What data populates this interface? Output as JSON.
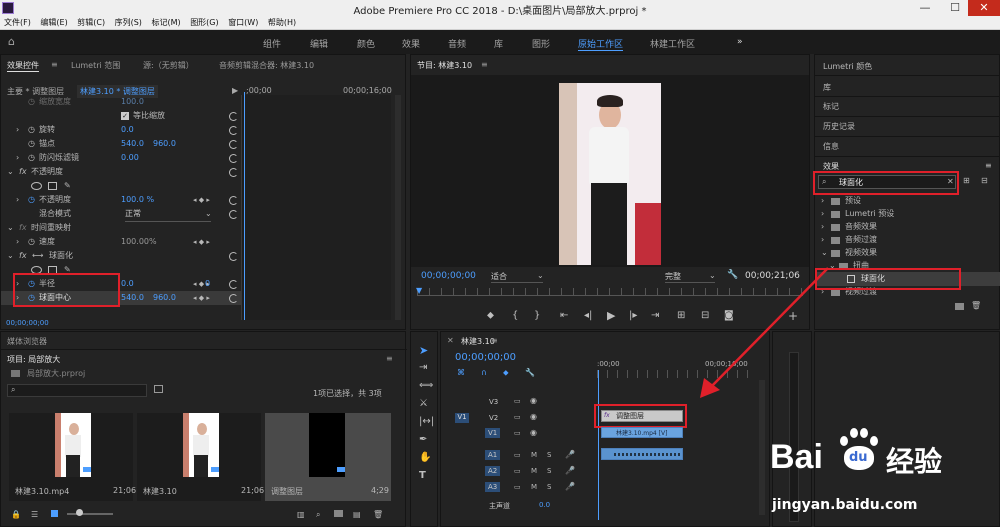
{
  "titlebar": {
    "title": "Adobe Premiere Pro CC 2018 - D:\\桌面图片\\局部放大.prproj *",
    "minimize": "—",
    "maximize": "☐",
    "close": "✕"
  },
  "menu": [
    "文件(F)",
    "编辑(E)",
    "剪辑(C)",
    "序列(S)",
    "标记(M)",
    "图形(G)",
    "窗口(W)",
    "帮助(H)"
  ],
  "workspaces": [
    "组件",
    "编辑",
    "颜色",
    "效果",
    "音频",
    "库",
    "图形",
    "原始工作区",
    "林建工作区"
  ],
  "workspace_more": "»",
  "effect_controls": {
    "tabs": [
      "效果控件",
      "Lumetri 范围",
      "源:（无剪辑）",
      "音频剪辑混合器: 林建3.10"
    ],
    "tab_menu": "≡",
    "source_label": "主要 * 调整图层",
    "clip_label": "林建3.10 * 调整图层",
    "time_marks": [
      ";00;00",
      "00;00;16;00"
    ],
    "rows": [
      {
        "label": "缩放宽度",
        "v1": "100.0",
        "v2": ""
      },
      {
        "label": "等比缩放",
        "v1": "",
        "v2": ""
      },
      {
        "label": "旋转",
        "v1": "0.0",
        "v2": ""
      },
      {
        "label": "锚点",
        "v1": "540.0",
        "v2": "960.0"
      },
      {
        "label": "防闪烁滤镜",
        "v1": "0.00",
        "v2": ""
      },
      {
        "label": "不透明度",
        "v1": "",
        "v2": ""
      },
      {
        "label": "",
        "v1": "",
        "v2": ""
      },
      {
        "label": "不透明度",
        "v1": "100.0 %",
        "v2": ""
      },
      {
        "label": "混合模式",
        "v1": "正常",
        "v2": ""
      },
      {
        "label": "时间重映射",
        "v1": "",
        "v2": ""
      },
      {
        "label": "速度",
        "v1": "100.00%",
        "v2": ""
      },
      {
        "label": "球面化",
        "v1": "",
        "v2": ""
      },
      {
        "label": "",
        "v1": "",
        "v2": ""
      },
      {
        "label": "半径",
        "v1": "0.0",
        "v2": "0"
      },
      {
        "label": "球面中心",
        "v1": "540.0",
        "v2": "960.0"
      }
    ],
    "timecode": "00;00;00;00"
  },
  "program": {
    "title": "节目: 林建3.10",
    "menu": "≡",
    "timecode": "00;00;00;00",
    "fit": "适合",
    "quality": "完整",
    "duration": "00;00;21;06"
  },
  "right_panels": [
    "Lumetri 颜色",
    "库",
    "标记",
    "历史记录",
    "信息"
  ],
  "effects_panel": {
    "title": "效果",
    "menu": "≡",
    "search_value": "球面化",
    "tree": [
      "预设",
      "Lumetri 预设",
      "音频效果",
      "音频过渡",
      "视频效果",
      "扭曲",
      "球面化",
      "视频过渡"
    ]
  },
  "media_browser": {
    "title": "媒体浏览器"
  },
  "project": {
    "title": "项目: 局部放大",
    "menu": "≡",
    "file": "局部放大.prproj",
    "selection": "1项已选择，共 3项",
    "items": [
      {
        "name": "林建3.10.mp4",
        "dur": "21;06"
      },
      {
        "name": "林建3.10",
        "dur": "21;06"
      },
      {
        "name": "调整图层",
        "dur": "4;29"
      }
    ]
  },
  "timeline": {
    "title": "林建3.10",
    "menu": "≡",
    "timecode": "00;00;00;00",
    "ruler": [
      ":00;00",
      "00;00;16;00"
    ],
    "tracks": [
      "V3",
      "V2",
      "V1",
      "A1",
      "A2",
      "A3"
    ],
    "master": "主声道",
    "master_val": "0.0",
    "clip_adjust": "调整图层",
    "clip_video": "林建3.10.mp4 [V]"
  },
  "watermark": {
    "brand": "Bai",
    "brand2": "经验",
    "paw": "du",
    "url": "jingyan.baidu.com"
  },
  "colors": {
    "accent": "#4d9eff",
    "highlight": "#e0202a",
    "bg": "#232323"
  }
}
